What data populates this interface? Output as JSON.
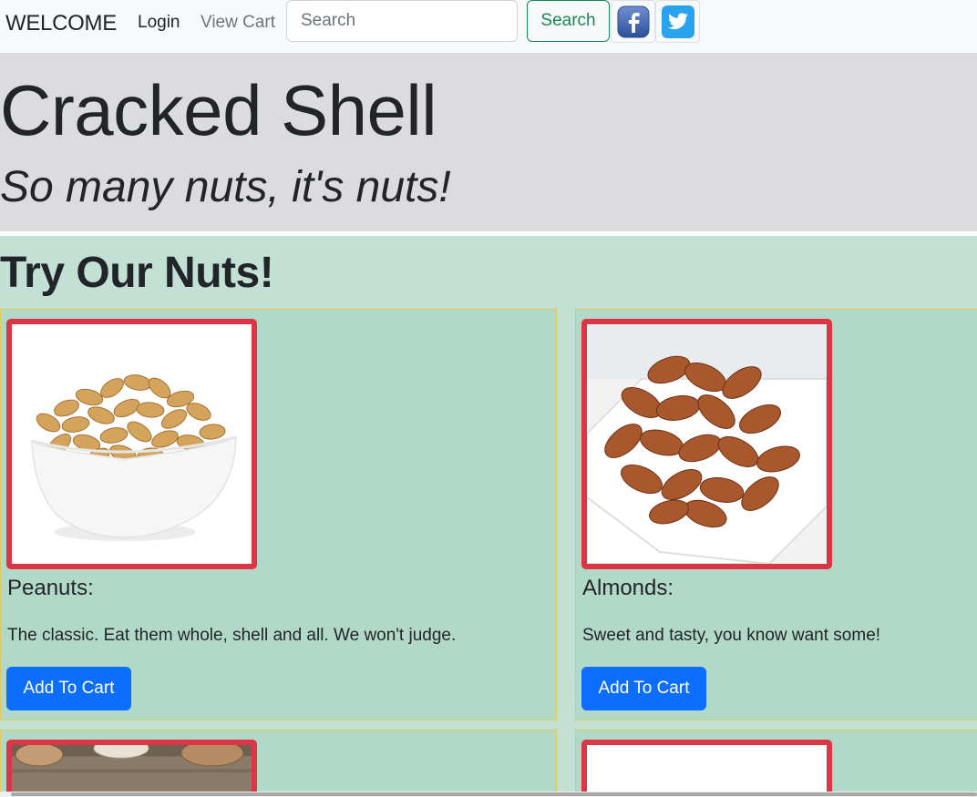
{
  "navbar": {
    "brand": "WELCOME",
    "login": "Login",
    "view_cart": "View Cart",
    "search_placeholder": "Search",
    "search_button": "Search",
    "social": [
      "facebook-icon",
      "twitter-icon"
    ]
  },
  "hero": {
    "title": "Cracked Shell",
    "subtitle": "So many nuts, it's nuts!"
  },
  "products": {
    "heading": "Try Our Nuts!",
    "items": [
      {
        "name": "Peanuts:",
        "description": "The classic. Eat them whole, shell and all. We won't judge.",
        "button": "Add To Cart",
        "image": "peanuts-bowl-image"
      },
      {
        "name": "Almonds:",
        "description": "Sweet and tasty, you know want some!",
        "button": "Add To Cart",
        "image": "almonds-bowl-image"
      },
      {
        "image": "brazil-nuts-image"
      },
      {
        "image": "white-product-image"
      }
    ]
  },
  "colors": {
    "navbar_bg": "#f8f9fa",
    "hero_bg": "#dcdcde",
    "section_bg": "#c3e0d4",
    "card_bg": "#b2d9c8",
    "card_border": "#e3c95a",
    "image_border": "#dc3545",
    "primary_button": "#0d6efd",
    "search_button": "#198754"
  }
}
